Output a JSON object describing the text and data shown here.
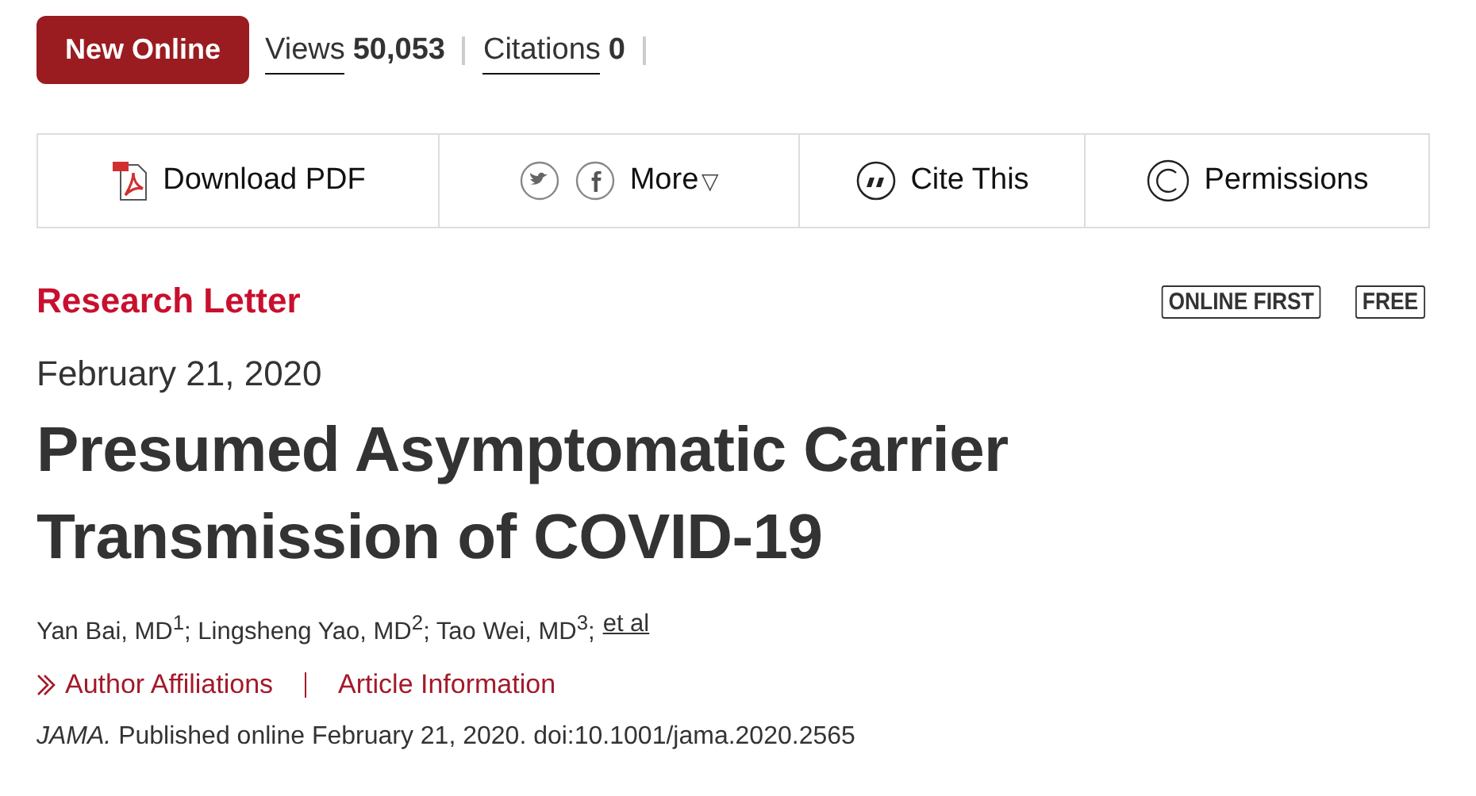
{
  "badge": "New Online",
  "metrics": [
    {
      "label": "Views",
      "value": "50,053"
    },
    {
      "label": "Citations",
      "value": "0"
    }
  ],
  "toolbar": [
    {
      "kind": "pdf",
      "label": "Download PDF"
    },
    {
      "kind": "share",
      "label": "More",
      "caret": "▽"
    },
    {
      "kind": "cite",
      "label": "Cite This"
    },
    {
      "kind": "permissions",
      "label": "Permissions"
    }
  ],
  "article_type": "Research Letter",
  "tags": [
    "ONLINE FIRST",
    "FREE"
  ],
  "date": "February 21, 2020",
  "title": "Presumed Asymptomatic Carrier Transmission of COVID-19",
  "authors": "Yan Bai, MD$^{1}$; Lingsheng Yao, MD$^{2}$; Tao Wei, MD$^{3}$;",
  "authors_link": "et al",
  "info_links": [
    "Author Affiliations",
    "Article Information"
  ],
  "citation": "*JAMA.* Published online February 21, 2020. doi:10.1001/jama.2020.2565"
}
